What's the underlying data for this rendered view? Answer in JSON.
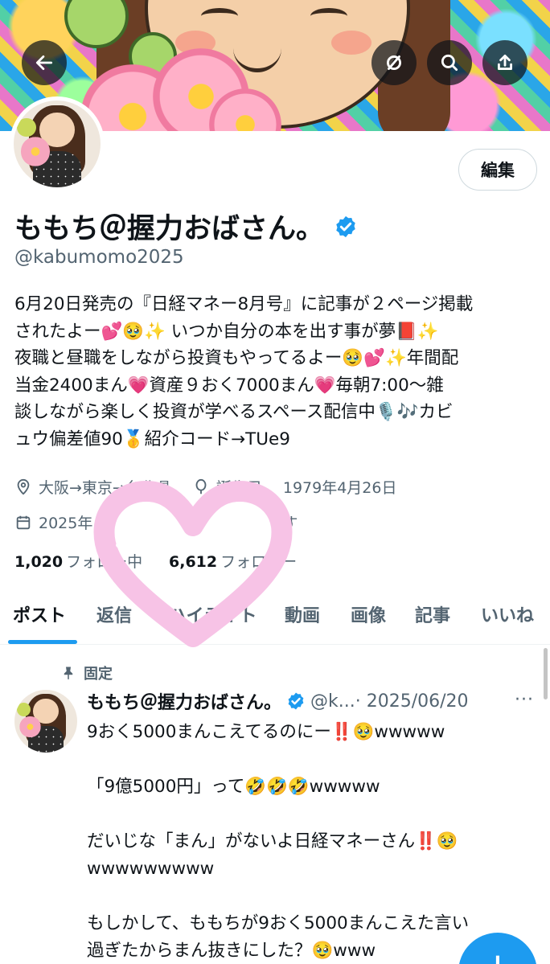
{
  "header": {
    "back_icon": "arrow-left-icon",
    "grok_icon": "grok-icon",
    "search_icon": "search-icon",
    "share_icon": "share-icon"
  },
  "profile": {
    "edit_label": "編集",
    "name": "ももち＠握力おばさん。",
    "handle": "@kabumomo2025",
    "bio_lines": [
      "6月20日発売の『日経マネー8月号』に記事が２ページ掲載",
      "されたよー💕🥹✨ いつか自分の本を出す事が夢📕✨",
      "夜職と昼職をしながら投資もやってるよー🥹💕✨年間配",
      "当金2400まん💗資産９おく7000まん💗毎朝7:00～雑",
      "談しながら楽しく投資が学べるスペース配信中🎙️🎶カビ",
      "ュウ偏差値90🥇紹介コード→TUe9"
    ],
    "location": "大阪→東京→台北県",
    "birthday_label": "誕生日",
    "birthday": "1979年4月26日",
    "joined_prefix": "2025年",
    "joined_suffix": "す",
    "following_count": "1,020",
    "following_label": "フォロー中",
    "followers_count": "6,612",
    "followers_label": "フォロワー"
  },
  "tabs": [
    "ポスト",
    "返信",
    "ハイライト",
    "動画",
    "画像",
    "記事",
    "いいね"
  ],
  "post": {
    "pinned_label": "固定",
    "name": "ももち＠握力おばさん。",
    "handle": "@k...",
    "date": "· 2025/06/20",
    "more": "···",
    "body_lines": [
      "9おく5000まんこえてるのにー‼️🥹wwwww",
      "",
      "「9億5000円」って🤣🤣🤣wwwww",
      "",
      "だいじな「まん」がないよ日経マネーさん‼️🥹",
      "wwwwwwwww",
      "",
      "もしかして、ももちが9おく5000まんこえた言い",
      "過ぎたからまん抜きにした？🥹www"
    ]
  },
  "fab": {
    "label": "+"
  },
  "colors": {
    "accent": "#1d9bf0",
    "verified": "#1d9bf0",
    "heart": "#f7c3e6"
  }
}
